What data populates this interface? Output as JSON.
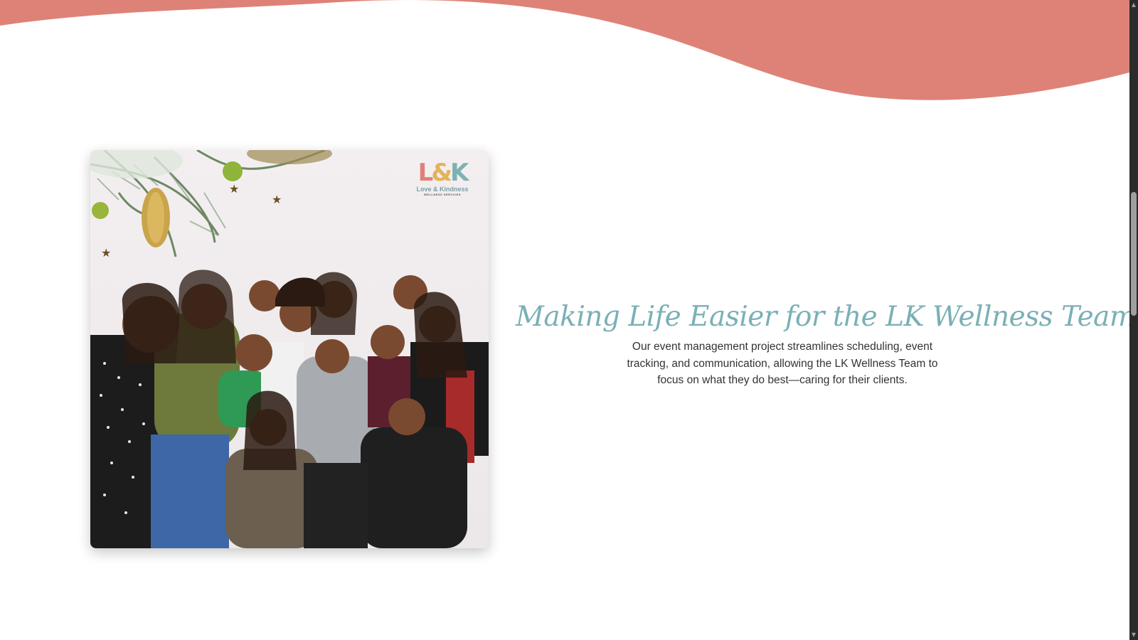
{
  "page": {
    "background": "#ffffff",
    "wave_color": "#de8277"
  },
  "photo": {
    "alt": "LK Wellness Team group photo",
    "logo": {
      "mark_l": "L",
      "mark_amp": "&",
      "mark_k": "K",
      "name": "Love & Kindness",
      "tagline": "WELLNESS SERVICES"
    }
  },
  "section": {
    "heading": "Making Life Easier for the LK Wellness Team",
    "body": "Our event management project streamlines scheduling, event tracking, and communication, allowing the LK Wellness Team to focus on what they do best—caring for their clients.",
    "heading_color": "#7ab0b6",
    "body_color": "#333333"
  },
  "scrollbar": {
    "up_icon": "arrow-up-icon",
    "down_icon": "arrow-down-icon",
    "up_glyph": "▲",
    "down_glyph": "▼"
  }
}
